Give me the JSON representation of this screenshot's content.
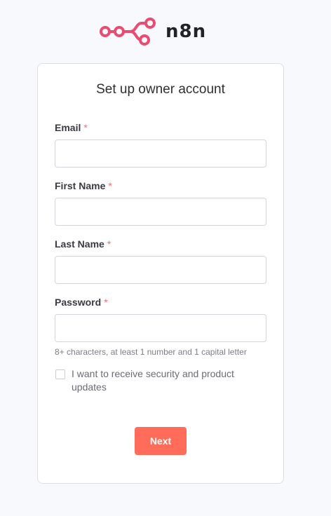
{
  "brand": {
    "name": "n8n",
    "logo_icon": "n8n-nodes-logo-icon",
    "logo_color": "#ea4b71"
  },
  "form": {
    "title": "Set up owner account",
    "required_marker": "*",
    "fields": [
      {
        "label": "Email",
        "value": "",
        "placeholder": "",
        "required": true
      },
      {
        "label": "First Name",
        "value": "",
        "placeholder": "",
        "required": true
      },
      {
        "label": "Last Name",
        "value": "",
        "placeholder": "",
        "required": true
      },
      {
        "label": "Password",
        "value": "",
        "placeholder": "",
        "required": true
      }
    ],
    "password_hint": "8+ characters, at least 1 number and 1 capital letter",
    "updates_checkbox": {
      "label": "I want to receive security and product updates",
      "checked": false
    },
    "submit_label": "Next"
  },
  "colors": {
    "accent": "#ff6d5a",
    "required": "#f56c6c",
    "background": "#f8f9fc"
  }
}
